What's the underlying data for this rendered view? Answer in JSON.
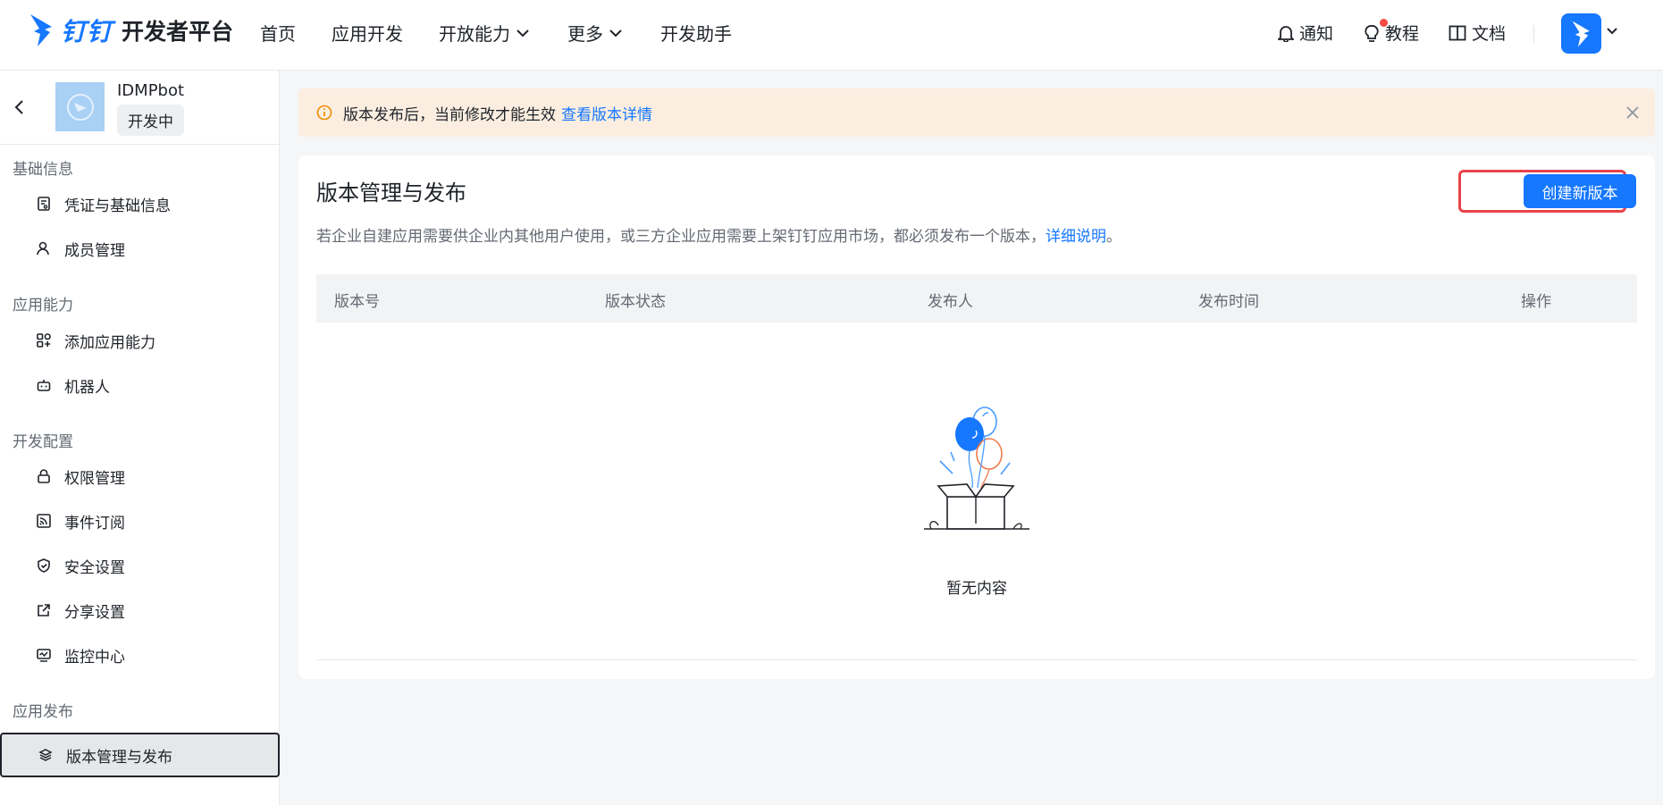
{
  "topnav": {
    "brand": "钉钉",
    "title": "开发者平台",
    "items": [
      {
        "label": "首页",
        "dropdown": false
      },
      {
        "label": "应用开发",
        "dropdown": false
      },
      {
        "label": "开放能力",
        "dropdown": true
      },
      {
        "label": "更多",
        "dropdown": true
      },
      {
        "label": "开发助手",
        "dropdown": false
      }
    ],
    "right": {
      "notify": "通知",
      "tutorial": "教程",
      "docs": "文档"
    },
    "accent": "#1677ff"
  },
  "sidebar": {
    "app_name": "IDMPbot",
    "app_status": "开发中",
    "sections": [
      {
        "title": "基础信息",
        "items": [
          {
            "label": "凭证与基础信息",
            "icon": "credential-icon"
          },
          {
            "label": "成员管理",
            "icon": "user-icon"
          }
        ]
      },
      {
        "title": "应用能力",
        "items": [
          {
            "label": "添加应用能力",
            "icon": "grid-plus-icon"
          },
          {
            "label": "机器人",
            "icon": "robot-icon"
          }
        ]
      },
      {
        "title": "开发配置",
        "items": [
          {
            "label": "权限管理",
            "icon": "lock-icon"
          },
          {
            "label": "事件订阅",
            "icon": "rss-icon"
          },
          {
            "label": "安全设置",
            "icon": "shield-icon"
          },
          {
            "label": "分享设置",
            "icon": "share-icon"
          },
          {
            "label": "监控中心",
            "icon": "monitor-icon"
          }
        ]
      },
      {
        "title": "应用发布",
        "items": [
          {
            "label": "版本管理与发布",
            "icon": "layers-icon",
            "active": true
          }
        ]
      }
    ]
  },
  "notice": {
    "text": "版本发布后，当前修改才能生效",
    "link": "查看版本详情",
    "bg": "#fbeee0"
  },
  "main": {
    "title": "版本管理与发布",
    "description": "若企业自建应用需要供企业内其他用户使用，或三方企业应用需要上架钉钉应用市场，都必须发布一个版本，",
    "description_link": "详细说明",
    "description_end": "。",
    "create_button": "创建新版本",
    "table": {
      "columns": [
        "版本号",
        "版本状态",
        "发布人",
        "发布时间",
        "操作"
      ]
    },
    "empty_text": "暂无内容"
  }
}
